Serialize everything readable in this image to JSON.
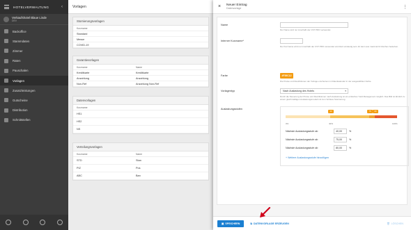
{
  "sidebar": {
    "title": "HOTELVERWALTUNG",
    "hotel_name": "Verkaufshotel Blaue Linde",
    "hotel_sub": "DEV",
    "items": [
      {
        "label": "Backoffice",
        "active": false
      },
      {
        "label": "Stammdaten",
        "active": false
      },
      {
        "label": "Zimmer",
        "active": false
      },
      {
        "label": "Raten",
        "active": false
      },
      {
        "label": "Pauschalen",
        "active": false
      },
      {
        "label": "Vorlagen",
        "active": true
      },
      {
        "label": "Zusatzleistungen",
        "active": false
      },
      {
        "label": "Gutscheine",
        "active": false
      },
      {
        "label": "Distribution",
        "active": false
      },
      {
        "label": "Schnittstellen",
        "active": false
      }
    ]
  },
  "main": {
    "title": "Vorlagen",
    "cards": [
      {
        "title": "Stornierungsvorlagen",
        "headers": [
          "Kurzname",
          ""
        ],
        "rows": [
          [
            "Standard",
            ""
          ],
          [
            "Messe",
            ""
          ],
          [
            "COVID-19",
            ""
          ]
        ]
      },
      {
        "title": "Garantievorlagen",
        "headers": [
          "Kurzname",
          "Name"
        ],
        "rows": [
          [
            "Kreditkarte",
            "Kreditkarte"
          ],
          [
            "Anzahlung",
            "Anzahlung"
          ],
          [
            "Non-Ref",
            "Anzahlung Non-Ref"
          ]
        ]
      },
      {
        "title": "Datenvorlagen",
        "headers": [
          "Kurzname",
          ""
        ],
        "rows": [
          [
            "HS1",
            ""
          ],
          [
            "HS2",
            ""
          ],
          [
            "NS",
            ""
          ]
        ]
      },
      {
        "title": "Verteilungsvorlagen",
        "headers": [
          "Kurzname",
          "Name"
        ],
        "rows": [
          [
            "STD",
            "Stan"
          ],
          [
            "PIZ",
            "Pos"
          ],
          [
            "ABC",
            "Ban"
          ]
        ]
      }
    ]
  },
  "overlay": {
    "title": "Neuer Eintrag",
    "subtitle": "Datenvorlage",
    "fields": {
      "name_label": "Name",
      "name_help": "Der Name wird nur innerhalb der CST PRO verwendet.",
      "internal_label": "Interner Kurzname*",
      "internal_help": "Der Kurzname wird nur innerhalb der CST PRO verwendet und dient eindeutig sein. Er kann aus maximal 10 Zeichen bestehen.",
      "color_label": "Farbe",
      "color_value": "#F39C12",
      "color_button": "#F39C12",
      "color_help": "Die Preise und Restriktionen der Vorlage erscheinen im Ratenkalender in der ausgewählten Farbe.",
      "type_label": "Vorlagentyp",
      "type_value": "Nach Auslastung des Hotels",
      "type_help": "Durch die Steuerung der Preise und Restriktionen nach Auslastung ist ein einfaches Yield Management möglich. Das Bild ist ähnlich zu einem gleichmäßigen Auslastungsmodell mit zum Schluss Stornierung.",
      "levels_label": "Auslastungsstufen"
    },
    "chart": {
      "markers": [
        "40",
        "75",
        "80"
      ],
      "ticks": [
        "0%",
        "40%",
        "100%"
      ]
    },
    "levels": [
      {
        "label": "Nächste Auslastungsstufe ab",
        "value": "40,00",
        "unit": "%"
      },
      {
        "label": "Nächste Auslastungsstufe ab",
        "value": "75,00",
        "unit": "%"
      },
      {
        "label": "Nächste Auslastungsstufe ab",
        "value": "80,00",
        "unit": "%"
      }
    ],
    "add_level": "+ Weitere Auslastungsstufe hinzufügen",
    "footer": {
      "save": "SPEICHERN",
      "create_template": "DATENVORLAGE ERZEUGEN",
      "delete": "LÖSCHEN"
    }
  },
  "colors": {
    "accent": "#1b7fd1",
    "template_color": "#f39c12",
    "sidebar_bg": "#3c3c3c",
    "arrow": "#d0021b"
  }
}
